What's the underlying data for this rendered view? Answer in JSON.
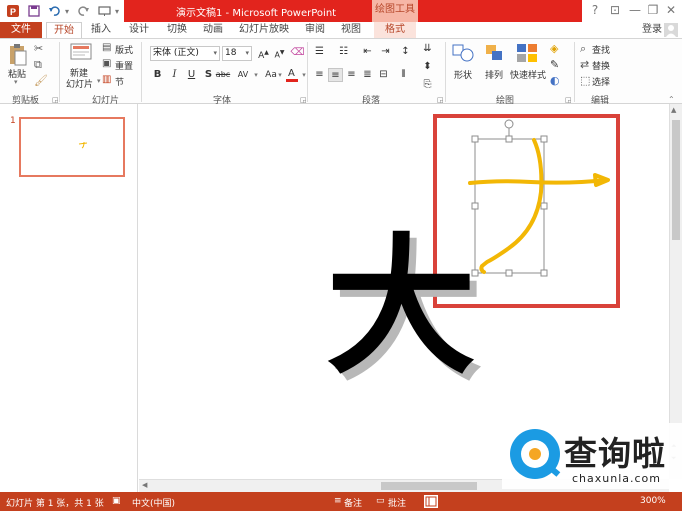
{
  "app": {
    "title": "演示文稿1 - Microsoft PowerPoint",
    "context_tool": "绘图工具",
    "sign_in": "登录",
    "accent_color": "#c4401e",
    "title_bar_color": "#e2241d"
  },
  "quick_access": [
    "save-icon",
    "undo-icon",
    "redo-icon",
    "present-icon"
  ],
  "tabs": [
    {
      "label": "文件"
    },
    {
      "label": "开始"
    },
    {
      "label": "插入"
    },
    {
      "label": "设计"
    },
    {
      "label": "切换"
    },
    {
      "label": "动画"
    },
    {
      "label": "幻灯片放映"
    },
    {
      "label": "审阅"
    },
    {
      "label": "视图"
    },
    {
      "label": "格式"
    }
  ],
  "ribbon": {
    "clipboard": {
      "label": "剪贴板",
      "paste": "粘贴"
    },
    "slides": {
      "label": "幻灯片",
      "new_slide_1": "新建",
      "new_slide_2": "幻灯片",
      "layout": "版式",
      "reset": "重置",
      "section": "节"
    },
    "font": {
      "label": "字体",
      "font_name": "宋体 (正文)",
      "font_size": "18",
      "font_color": "#e2241d",
      "bold": "B",
      "italic": "I",
      "underline": "U",
      "shadow": "S",
      "strike": "abc",
      "spacing": "AV",
      "case": "Aa"
    },
    "paragraph": {
      "label": "段落"
    },
    "drawing": {
      "label": "绘图",
      "shapes": "形状",
      "arrange": "排列",
      "quick_styles": "快速样式"
    },
    "editing": {
      "label": "编辑",
      "find": "查找",
      "replace": "替换",
      "select": "选择"
    }
  },
  "thumbnails": {
    "slide_number": "1"
  },
  "slide": {
    "big_char": "大",
    "highlight_box_color": "#d9423a",
    "ink_color": "#f2b705"
  },
  "status": {
    "slide_info": "幻灯片 第 1 张，共 1 张",
    "language": "中文(中国)",
    "notes": "备注",
    "comments": "批注",
    "zoom": "300%"
  },
  "watermark": {
    "text": "查询啦",
    "site": "chaxunla.com"
  }
}
